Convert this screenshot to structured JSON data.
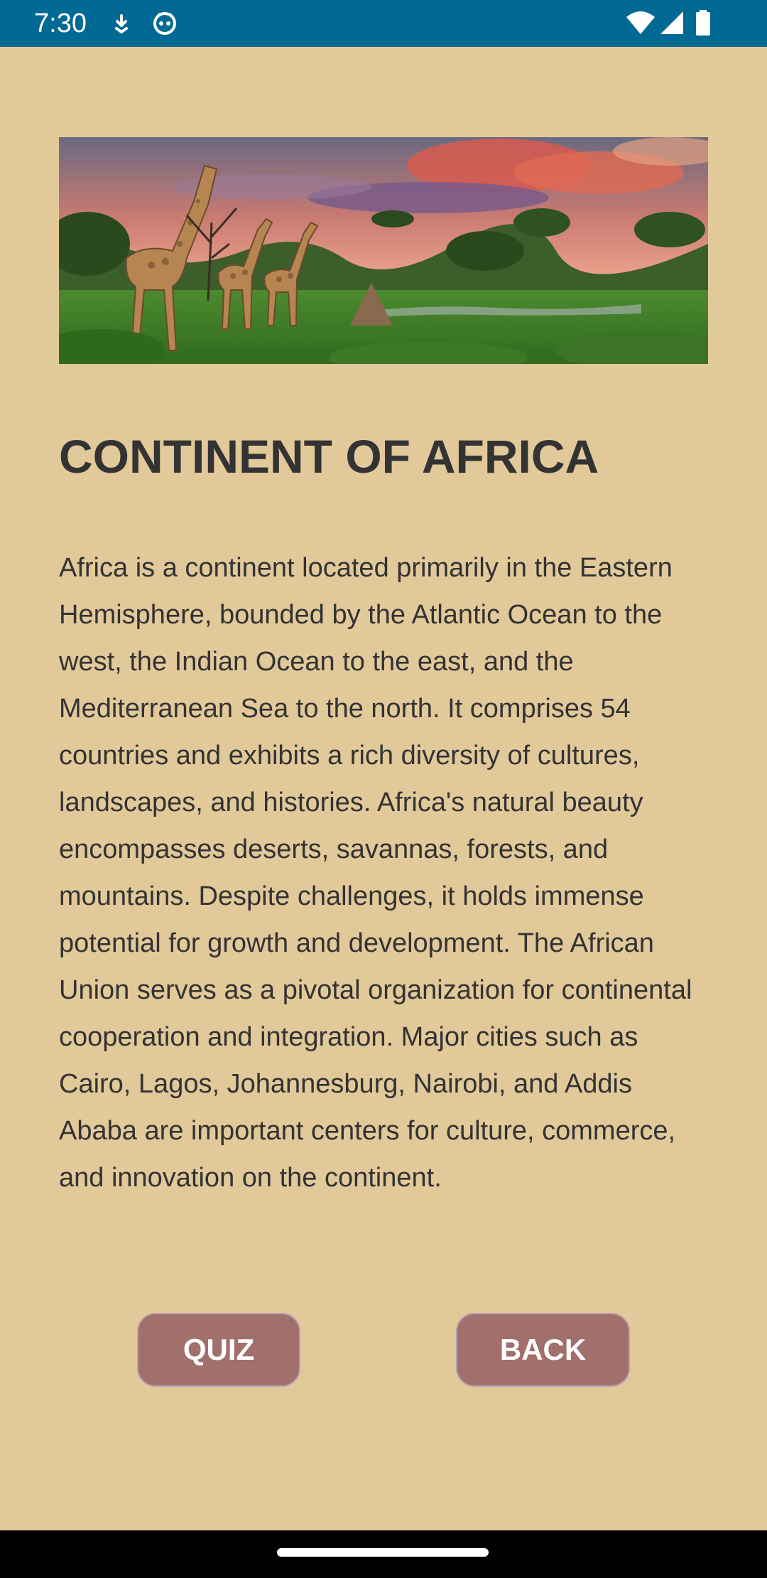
{
  "status_bar": {
    "time": "7:30",
    "icons": [
      "download-icon",
      "face-icon",
      "wifi-icon",
      "signal-icon",
      "battery-icon"
    ],
    "color": "#006994"
  },
  "hero_image": {
    "description_icon": "africa-savanna-giraffes-image"
  },
  "content": {
    "title": "CONTINENT OF AFRICA",
    "body": "Africa is a continent located primarily in the Eastern Hemisphere, bounded by the Atlantic Ocean to the west, the Indian Ocean to the east, and the Mediterranean Sea to the north. It comprises 54 countries and exhibits a rich diversity of cultures, landscapes, and histories. Africa's natural beauty encompasses deserts, savannas, forests, and mountains. Despite challenges, it holds immense potential for growth and development. The African Union serves as a pivotal organization for continental cooperation and integration. Major cities such as Cairo, Lagos, Johannesburg, Nairobi, and Addis Ababa are important centers for culture, commerce, and innovation on the continent."
  },
  "buttons": {
    "quiz_label": "QUIZ",
    "back_label": "BACK"
  },
  "colors": {
    "background": "#E2C99A",
    "button": "#A1706A",
    "text": "#333333"
  }
}
